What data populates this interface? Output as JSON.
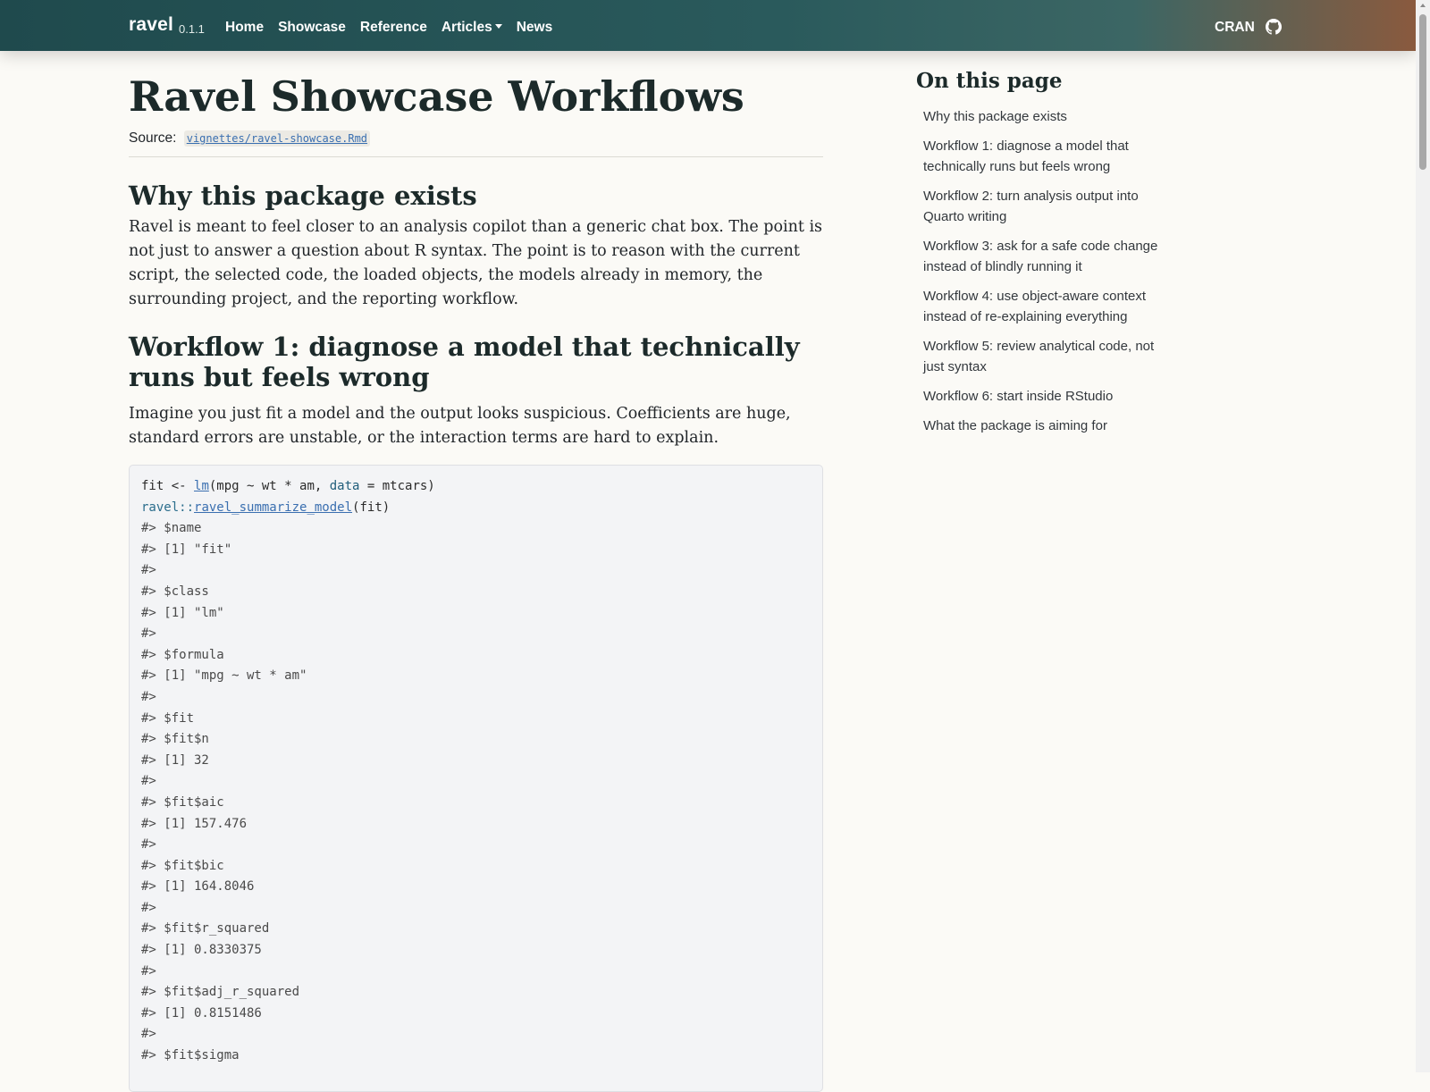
{
  "navbar": {
    "brand": "ravel",
    "version": "0.1.1",
    "links": [
      "Home",
      "Showcase",
      "Reference",
      "Articles",
      "News"
    ],
    "cran": "CRAN",
    "github_icon": "github-icon"
  },
  "page": {
    "title": "Ravel Showcase Workflows",
    "source_label": "Source:",
    "source_file": "vignettes/ravel-showcase.Rmd"
  },
  "sections": [
    {
      "heading": "Why this package exists",
      "body": "Ravel is meant to feel closer to an analysis copilot than a generic chat box. The point is not just to answer a question about R syntax. The point is to reason with the current script, the selected code, the loaded objects, the models already in memory, the surrounding project, and the reporting workflow."
    },
    {
      "heading": "Workflow 1: diagnose a model that technically runs but feels wrong",
      "body": "Imagine you just fit a model and the output looks suspicious. Coefficients are huge, standard errors are unstable, or the interaction terms are hard to explain."
    }
  ],
  "code": {
    "line1": {
      "a": "fit <- ",
      "fn": "lm",
      "b": "(mpg ~ wt * am, ",
      "arg": "data",
      "c": " = mtcars)"
    },
    "line2": {
      "ns": "ravel::",
      "fn": "ravel_summarize_model",
      "b": "(fit)"
    },
    "output": [
      "#> $name",
      "#> [1] \"fit\"",
      "#>",
      "#> $class",
      "#> [1] \"lm\"",
      "#>",
      "#> $formula",
      "#> [1] \"mpg ~ wt * am\"",
      "#>",
      "#> $fit",
      "#> $fit$n",
      "#> [1] 32",
      "#>",
      "#> $fit$aic",
      "#> [1] 157.476",
      "#>",
      "#> $fit$bic",
      "#> [1] 164.8046",
      "#>",
      "#> $fit$r_squared",
      "#> [1] 0.8330375",
      "#>",
      "#> $fit$adj_r_squared",
      "#> [1] 0.8151486",
      "#>",
      "#> $fit$sigma"
    ]
  },
  "toc": {
    "title": "On this page",
    "items": [
      "Why this package exists",
      "Workflow 1: diagnose a model that technically runs but feels wrong",
      "Workflow 2: turn analysis output into Quarto writing",
      "Workflow 3: ask for a safe code change instead of blindly running it",
      "Workflow 4: use object-aware context instead of re-explaining everything",
      "Workflow 5: review analytical code, not just syntax",
      "Workflow 6: start inside RStudio",
      "What the package is aiming for"
    ]
  }
}
